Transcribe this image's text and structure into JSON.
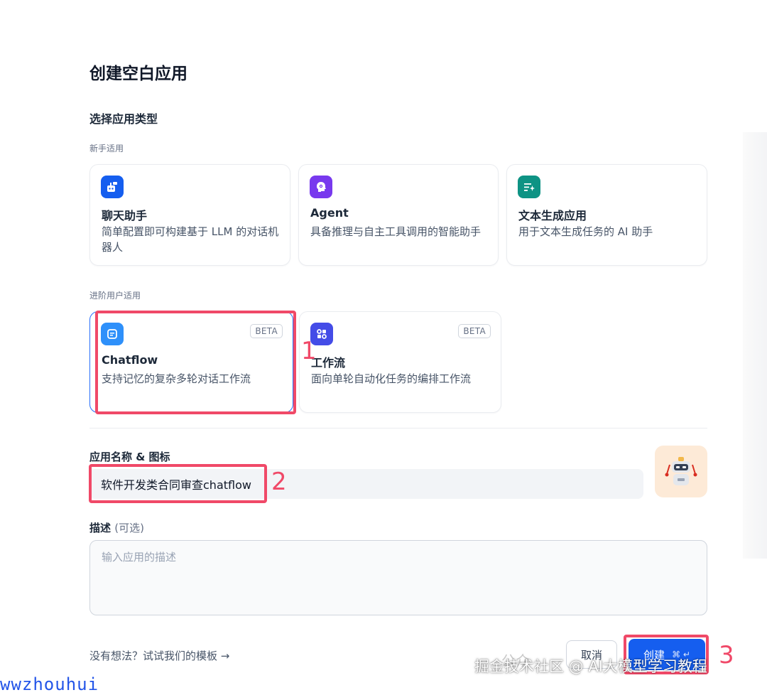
{
  "page": {
    "title": "创建空白应用",
    "section_title": "选择应用类型"
  },
  "beginner": {
    "label": "新手适用",
    "cards": [
      {
        "title": "聊天助手",
        "desc": "简单配置即可构建基于 LLM 的对话机器人",
        "icon": "chat-bot-icon",
        "color": "#155eef"
      },
      {
        "title": "Agent",
        "desc": "具备推理与自主工具调用的智能助手",
        "icon": "agent-icon",
        "color": "#7839ee"
      },
      {
        "title": "文本生成应用",
        "desc": "用于文本生成任务的 AI 助手",
        "icon": "text-generate-icon",
        "color": "#0e9384"
      }
    ]
  },
  "advanced": {
    "label": "进阶用户适用",
    "cards": [
      {
        "title": "Chatflow",
        "desc": "支持记忆的复杂多轮对话工作流",
        "badge": "BETA",
        "icon": "chatflow-icon",
        "color": "#1570ef",
        "selected": true
      },
      {
        "title": "工作流",
        "desc": "面向单轮自动化任务的编排工作流",
        "badge": "BETA",
        "icon": "workflow-icon",
        "color": "#444ce7"
      }
    ]
  },
  "form": {
    "name_label": "应用名称 & 图标",
    "name_value": "软件开发类合同审查chatflow",
    "desc_label": "描述",
    "desc_optional": "(可选)",
    "desc_placeholder": "输入应用的描述"
  },
  "footer": {
    "template_link": "没有想法？试试我们的模板 →",
    "cancel_label": "取消",
    "create_label": "创建",
    "create_shortcut": "⌘ ↵"
  },
  "annotations": [
    "1",
    "2",
    "3"
  ],
  "watermarks": {
    "wechat": "公众",
    "platform": "掘金技术社区 @ AI大模型学习教程",
    "author": "wwzhouhui"
  }
}
